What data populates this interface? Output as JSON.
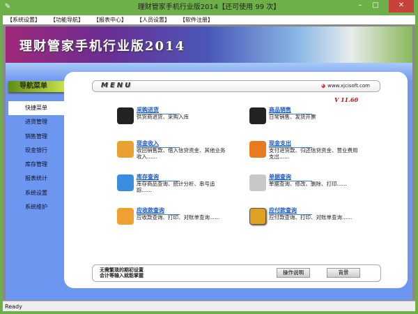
{
  "window": {
    "title": "理财管家手机行业版2014【还可使用 99 次】",
    "minimize": "–",
    "maximize": "□",
    "close": "✕"
  },
  "menubar": [
    "【系统设置】",
    "【功能导航】",
    "【报表中心】",
    "【人员设置】",
    "【软件注册】"
  ],
  "banner": {
    "title": "理财管家手机行业版2014"
  },
  "nav": {
    "header": "导航菜单",
    "items": [
      "快捷菜单",
      "进货管理",
      "销售管理",
      "现金银行",
      "库存管理",
      "报表统计",
      "系统设置",
      "系统维护"
    ],
    "active": 0
  },
  "menu": {
    "label": "MENU",
    "site": "www.xjcisoft.com",
    "version": "V 11.60"
  },
  "items": [
    {
      "title": "采购进货",
      "desc": "供货商进货、采购入库",
      "icon": "register-icon",
      "color": "#222"
    },
    {
      "title": "商品销售",
      "desc": "日常销售、发货开票",
      "icon": "register-icon",
      "color": "#222"
    },
    {
      "title": "现金收入",
      "desc": "收回销售款、借入信贷资金、其他业务收入......",
      "icon": "cash-in-icon",
      "color": "#e8a030"
    },
    {
      "title": "现金支出",
      "desc": "支付进货款、归还信贷资金、营业费用支出......",
      "icon": "cash-out-icon",
      "color": "#e87a20"
    },
    {
      "title": "库存查询",
      "desc": "库存商品查询、统计分析、串号追踪......",
      "icon": "pie-chart-icon",
      "color": "#3a8ee0"
    },
    {
      "title": "单据查询",
      "desc": "单据查询、修改、删除、打印......",
      "icon": "document-icon",
      "color": "#c8c8c8"
    },
    {
      "title": "应收款查询",
      "desc": "应收款查询、打印、对账单查询......",
      "icon": "receivable-icon",
      "color": "#f0a030"
    },
    {
      "title": "应付款查询",
      "desc": "应付款查询、打印、对账单查询......",
      "icon": "payable-icon",
      "color": "#e0a020"
    }
  ],
  "footer": {
    "line1": "无需繁琐的期初设置",
    "line2": "会计等输入就能掌握",
    "help_button": "操作说明",
    "second_button": "背景"
  },
  "status": "Ready"
}
